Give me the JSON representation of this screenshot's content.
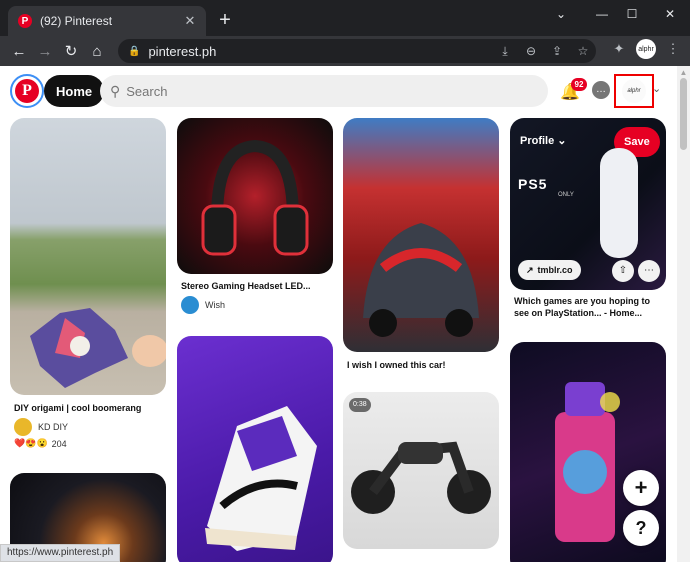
{
  "browser": {
    "tab_title": "(92) Pinterest",
    "tab_favicon_letter": "P",
    "new_tab_label": "+",
    "url": "pinterest.ph",
    "profile_chip_text": "alphr",
    "window_controls": [
      "minimize",
      "maximize",
      "close"
    ],
    "toolbar_icons": [
      "install-icon",
      "zoom-icon",
      "share-icon",
      "bookmark-star-icon",
      "extensions-icon",
      "menu-icon"
    ]
  },
  "header": {
    "logo_letter": "P",
    "home_label": "Home",
    "search_placeholder": "Search",
    "notification_count": "92",
    "avatar_text": "alphr"
  },
  "pins": [
    {
      "id": "origami",
      "caption": "DIY origami | cool boomerang",
      "author": "KD DIY",
      "reaction_count": "204",
      "reactions": [
        "❤️",
        "😍",
        "😮"
      ]
    },
    {
      "id": "headset",
      "caption": "Stereo Gaming Headset LED...",
      "author": "Wish"
    },
    {
      "id": "car",
      "caption": "I wish I owned this car!"
    },
    {
      "id": "ps5",
      "caption": "Which games are you hoping to see on PlayStation... - Home...",
      "profile_label": "Profile",
      "save_label": "Save",
      "link_label": "tmblr.co",
      "brand_text": "PS5",
      "brand_sub": "ONLY"
    },
    {
      "id": "motorcycle",
      "duration": "0:38"
    },
    {
      "id": "sneaker"
    },
    {
      "id": "light"
    },
    {
      "id": "spray"
    }
  ],
  "fab": {
    "add_label": "+",
    "help_label": "?"
  },
  "status_url": "https://www.pinterest.ph"
}
